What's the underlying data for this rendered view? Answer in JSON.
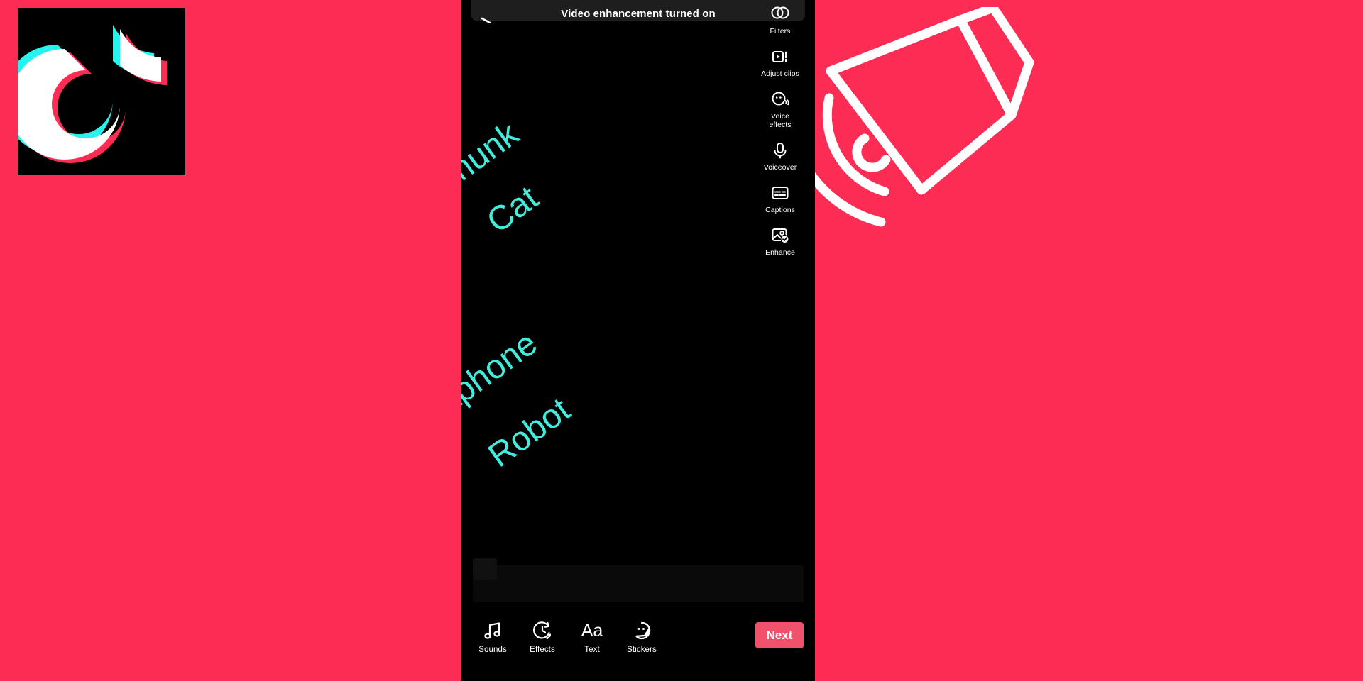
{
  "background_color": "#fc2c55",
  "brand": {
    "logo_name": "tiktok-logo",
    "logo_bg": "#000000",
    "logo_cyan": "#25f4ee",
    "logo_pink": "#fe2c55",
    "logo_white": "#ffffff"
  },
  "illustration": {
    "name": "megaphone-illustration",
    "stroke_color": "#ffffff"
  },
  "phone": {
    "screen_bg": "#000000",
    "toast": {
      "text": "Video enhancement turned on",
      "bg": "#1e1e1e",
      "text_color": "#ffffff"
    },
    "back_icon": "back-arrow-icon",
    "side_rail": [
      {
        "icon": "filters-icon",
        "label": "Filters"
      },
      {
        "icon": "adjust-clips-icon",
        "label": "Adjust clips"
      },
      {
        "icon": "voice-effects-icon",
        "label": "Voice\neffects",
        "line1": "Voice",
        "line2": "effects"
      },
      {
        "icon": "voiceover-icon",
        "label": "Voiceover"
      },
      {
        "icon": "captions-icon",
        "label": "Captions"
      },
      {
        "icon": "enhance-icon",
        "label": "Enhance"
      }
    ],
    "effect_labels": {
      "color": "#41ecdc",
      "rotation_deg": -36,
      "items": [
        {
          "text": "Chipmunk"
        },
        {
          "text": "Cat"
        },
        {
          "text": "Megaphone"
        },
        {
          "text": "Robot"
        }
      ]
    },
    "bottom_toolbar": {
      "tools": [
        {
          "icon": "music-note-icon",
          "label": "Sounds"
        },
        {
          "icon": "timer-icon",
          "label": "Effects"
        },
        {
          "icon": "text-aa-icon",
          "label": "Text",
          "glyph": "Aa"
        },
        {
          "icon": "sticker-icon",
          "label": "Stickers"
        }
      ],
      "next_label": "Next",
      "next_color": "#f0516b"
    }
  }
}
